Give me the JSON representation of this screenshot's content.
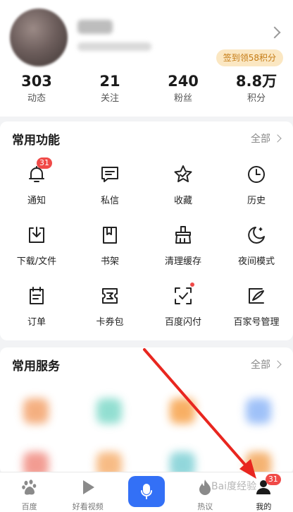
{
  "profile": {
    "checkin_label": "签到领58积分",
    "stats": [
      {
        "value": "303",
        "label": "动态"
      },
      {
        "value": "21",
        "label": "关注"
      },
      {
        "value": "240",
        "label": "粉丝"
      },
      {
        "value": "8.8万",
        "label": "积分"
      }
    ]
  },
  "functions": {
    "title": "常用功能",
    "more": "全部",
    "items": [
      {
        "label": "通知",
        "icon": "bell-icon",
        "badge": "31"
      },
      {
        "label": "私信",
        "icon": "chat-icon"
      },
      {
        "label": "收藏",
        "icon": "star-icon"
      },
      {
        "label": "历史",
        "icon": "clock-icon"
      },
      {
        "label": "下载/文件",
        "icon": "download-icon"
      },
      {
        "label": "书架",
        "icon": "bookshelf-icon"
      },
      {
        "label": "清理缓存",
        "icon": "broom-icon"
      },
      {
        "label": "夜间模式",
        "icon": "moon-icon"
      },
      {
        "label": "订单",
        "icon": "order-icon"
      },
      {
        "label": "卡券包",
        "icon": "coupon-icon"
      },
      {
        "label": "百度闪付",
        "icon": "scan-pay-icon",
        "dot": true
      },
      {
        "label": "百家号管理",
        "icon": "pen-paper-icon"
      }
    ]
  },
  "services": {
    "title": "常用服务",
    "more": "全部"
  },
  "bottom_nav": [
    {
      "label": "百度",
      "icon": "baidu-paw-icon"
    },
    {
      "label": "好看视频",
      "icon": "play-icon"
    },
    {
      "label": "",
      "icon": "microphone-icon"
    },
    {
      "label": "热议",
      "icon": "flame-icon"
    },
    {
      "label": "我的",
      "icon": "user-icon",
      "badge": "31"
    }
  ],
  "watermark": "Bai度经验",
  "colors": {
    "accent_blue": "#3370f6",
    "badge_red": "#f04a48",
    "checkin_bg": "#fbe7c2",
    "checkin_text": "#c47a13",
    "annotation_arrow": "#e8261f"
  }
}
